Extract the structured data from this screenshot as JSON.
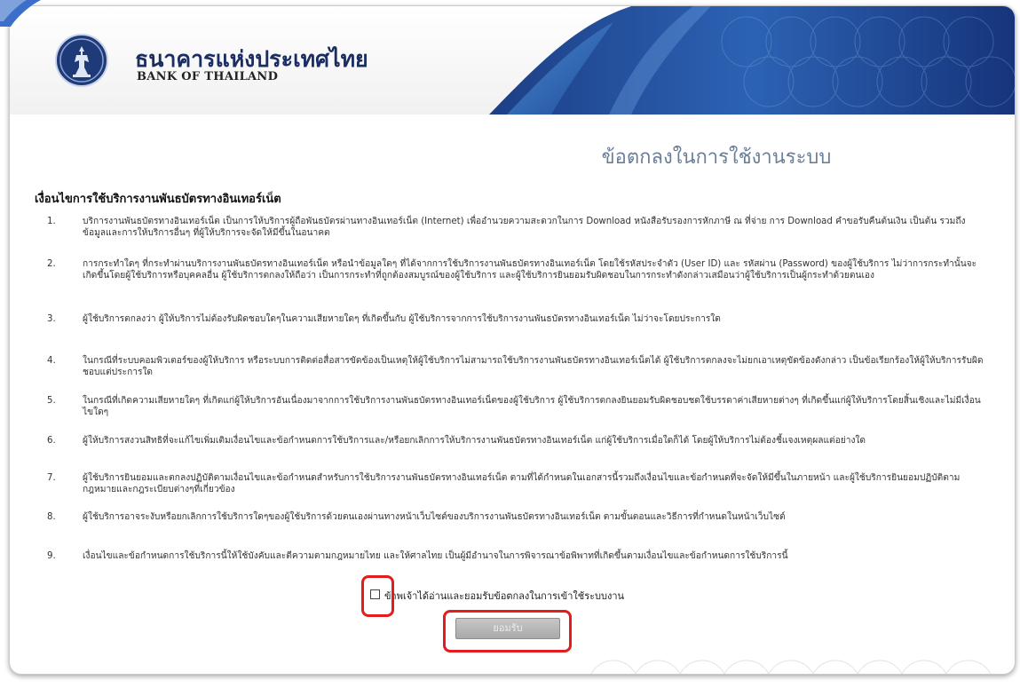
{
  "header": {
    "bank_name_thai": "ธนาคารแห่งประเทศไทย",
    "bank_name_english": "BANK OF THAILAND",
    "logo_icon": "garuda-seal-icon"
  },
  "page": {
    "title": "ข้อตกลงในการใช้งานระบบ"
  },
  "terms": {
    "heading": "เงื่อนไขการใช้บริการงานพันธบัตรทางอินเทอร์เน็ต",
    "items": [
      {
        "num": "1.",
        "text": "บริการงานพันธบัตรทางอินเทอร์เน็ต เป็นการให้บริการผู้ถือพันธบัตรผ่านทางอินเทอร์เน็ต (Internet) เพื่ออำนวยความสะดวกในการ Download หนังสือรับรองการหักภาษี ณ ที่จ่าย การ Download คำขอรับคืนต้นเงิน เป็นต้น รวมถึงข้อมูลและการให้บริการอื่นๆ ที่ผู้ให้บริการจะจัดให้มีขึ้นในอนาคต"
      },
      {
        "num": "2.",
        "text": "การกระทำใดๆ ที่กระทำผ่านบริการงานพันธบัตรทางอินเทอร์เน็ต หรือนำข้อมูลใดๆ ที่ได้จากการใช้บริการงานพันธบัตรทางอินเทอร์เน็ต โดยใช้รหัสประจำตัว (User ID) และ รหัสผ่าน (Password) ของผู้ใช้บริการ ไม่ว่าการกระทำนั้นจะเกิดขึ้นโดยผู้ใช้บริการหรือบุคคลอื่น ผู้ใช้บริการตกลงให้ถือว่า เป็นการกระทำที่ถูกต้องสมบูรณ์ของผู้ใช้บริการ และผู้ใช้บริการยินยอมรับผิดชอบในการกระทำดังกล่าวเสมือนว่าผู้ใช้บริการเป็นผู้กระทำด้วยตนเอง"
      },
      {
        "num": "3.",
        "text": "ผู้ใช้บริการตกลงว่า ผู้ให้บริการไม่ต้องรับผิดชอบใดๆในความเสียหายใดๆ ที่เกิดขึ้นกับ ผู้ใช้บริการจากการใช้บริการงานพันธบัตรทางอินเทอร์เน็ต ไม่ว่าจะโดยประการใด"
      },
      {
        "num": "4.",
        "text": "ในกรณีที่ระบบคอมพิวเตอร์ของผู้ให้บริการ หรือระบบการติดต่อสื่อสารขัดข้องเป็นเหตุให้ผู้ใช้บริการไม่สามารถใช้บริการงานพันธบัตรทางอินเทอร์เน็ตได้ ผู้ใช้บริการตกลงจะไม่ยกเอาเหตุขัดข้องดังกล่าว เป็นข้อเรียกร้องให้ผู้ให้บริการรับผิดชอบแต่ประการใด"
      },
      {
        "num": "5.",
        "text": "ในกรณีที่เกิดความเสียหายใดๆ ที่เกิดแก่ผู้ให้บริการอันเนื่องมาจากการใช้บริการงานพันธบัตรทางอินเทอร์เน็ตของผู้ใช้บริการ ผู้ใช้บริการตกลงยินยอมรับผิดชอบชดใช้บรรดาค่าเสียหายต่างๆ ที่เกิดขึ้นแก่ผู้ให้บริการโดยสิ้นเชิงและไม่มีเงื่อนไขใดๆ"
      },
      {
        "num": "6.",
        "text": "ผู้ให้บริการสงวนสิทธิที่จะแก้ไขเพิ่มเติมเงื่อนไขและข้อกำหนดการใช้บริการและ/หรือยกเลิกการให้บริการงานพันธบัตรทางอินเทอร์เน็ต แก่ผู้ใช้บริการเมื่อใดก็ได้ โดยผู้ให้บริการไม่ต้องชี้แจงเหตุผลแต่อย่างใด"
      },
      {
        "num": "7.",
        "text": "ผู้ใช้บริการยินยอมและตกลงปฏิบัติตามเงื่อนไขและข้อกำหนดสำหรับการใช้บริการงานพันธบัตรทางอินเทอร์เน็ต ตามที่ได้กำหนดในเอกสารนี้รวมถึงเงื่อนไขและข้อกำหนดที่จะจัดให้มีขึ้นในภายหน้า และผู้ใช้บริการยินยอมปฏิบัติตามกฎหมายและกฎระเบียบต่างๆที่เกี่ยวข้อง"
      },
      {
        "num": "8.",
        "text": "ผู้ใช้บริการอาจระงับหรือยกเลิกการใช้บริการใดๆของผู้ใช้บริการด้วยตนเองผ่านทางหน้าเว็บไซต์ของบริการงานพันธบัตรทางอินเทอร์เน็ต ตามขั้นตอนและวิธีการที่กำหนดในหน้าเว็บไซต์"
      },
      {
        "num": "9.",
        "text": "เงื่อนไขและข้อกำหนดการใช้บริการนี้ให้ใช้บังคับและตีความตามกฎหมายไทย และให้ศาลไทย เป็นผู้มีอำนาจในการพิจารณาข้อพิพาทที่เกิดขึ้นตามเงื่อนไขและข้อกำหนดการใช้บริการนี้"
      }
    ]
  },
  "agreement": {
    "checkbox_label": "ข้าพเจ้าได้อ่านและยอมรับข้อตกลงในการเข้าใช้ระบบงาน",
    "checked": false,
    "accept_label": "ยอมรับ"
  },
  "colors": {
    "brand_navy": "#1b2e63",
    "title_blue": "#6a7f99",
    "highlight_red": "#e21d1d"
  }
}
